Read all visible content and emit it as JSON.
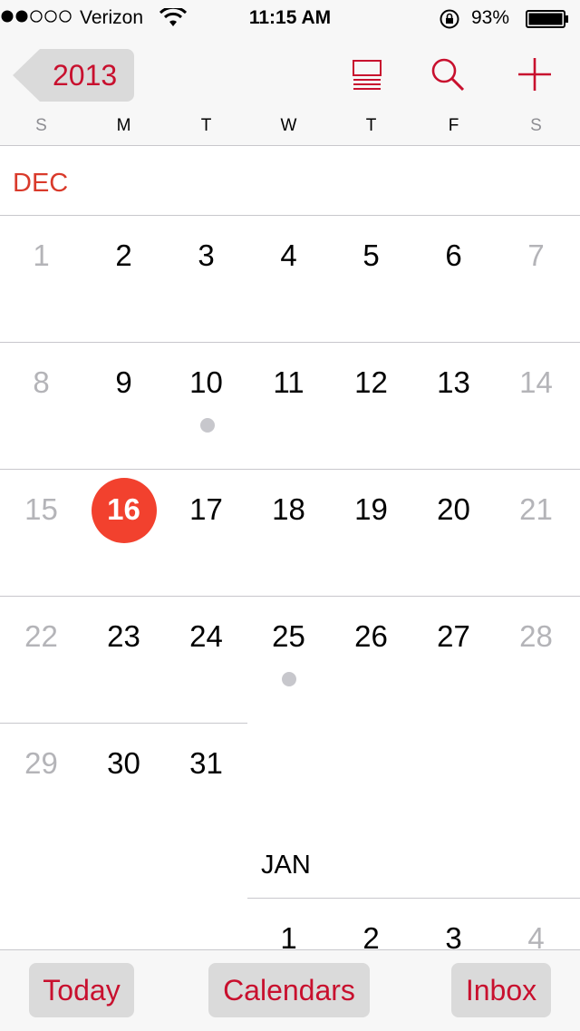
{
  "status_bar": {
    "carrier": "Verizon",
    "time": "11:15 AM",
    "battery_percent": "93%"
  },
  "nav": {
    "back_label": "2013",
    "icons": [
      "list-icon",
      "search-icon",
      "add-icon"
    ],
    "weekdays": [
      "S",
      "M",
      "T",
      "W",
      "T",
      "F",
      "S"
    ]
  },
  "month": {
    "name": "DEC",
    "weeks": [
      [
        "1",
        "2",
        "3",
        "4",
        "5",
        "6",
        "7"
      ],
      [
        "8",
        "9",
        "10",
        "11",
        "12",
        "13",
        "14"
      ],
      [
        "15",
        "16",
        "17",
        "18",
        "19",
        "20",
        "21"
      ],
      [
        "22",
        "23",
        "24",
        "25",
        "26",
        "27",
        "28"
      ],
      [
        "29",
        "30",
        "31"
      ]
    ],
    "today": "16",
    "event_days": [
      "10",
      "25"
    ]
  },
  "next_month": {
    "name": "JAN",
    "first_week": [
      "1",
      "2",
      "3",
      "4"
    ]
  },
  "toolbar": {
    "today_label": "Today",
    "calendars_label": "Calendars",
    "inbox_label": "Inbox"
  },
  "colors": {
    "accent": "#c8102e",
    "today_circle": "#f2412e",
    "month_label": "#d93a2b",
    "weekend_text": "#b4b4b8",
    "event_dot": "#c7c7cc"
  }
}
